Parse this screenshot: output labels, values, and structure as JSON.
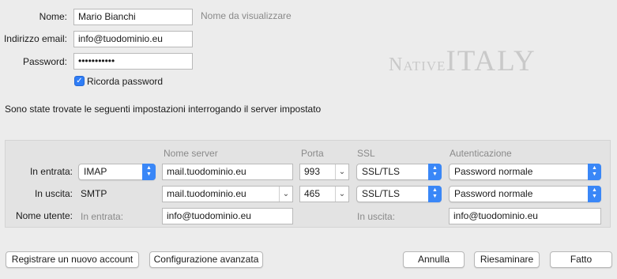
{
  "account": {
    "name_label": "Nome:",
    "name_value": "Mario Bianchi",
    "name_hint": "Nome da visualizzare",
    "email_label": "Indirizzo email:",
    "email_value": "info@tuodominio.eu",
    "password_label": "Password:",
    "password_value": "•••••••••••",
    "remember_label": "Ricorda password",
    "remember_checked": true
  },
  "logo": {
    "part1": "Native",
    "part2": "ITALY"
  },
  "message": "Sono state trovate le seguenti impostazioni interrogando il server impostato",
  "servers": {
    "headers": {
      "server": "Nome server",
      "port": "Porta",
      "ssl": "SSL",
      "auth": "Autenticazione"
    },
    "incoming": {
      "label": "In entrata:",
      "protocol": "IMAP",
      "server": "mail.tuodominio.eu",
      "port": "993",
      "ssl": "SSL/TLS",
      "auth": "Password normale"
    },
    "outgoing": {
      "label": "In uscita:",
      "protocol": "SMTP",
      "server": "mail.tuodominio.eu",
      "port": "465",
      "ssl": "SSL/TLS",
      "auth": "Password normale"
    },
    "username": {
      "label": "Nome utente:",
      "in_label": "In entrata:",
      "in_value": "info@tuodominio.eu",
      "out_label": "In uscita:",
      "out_value": "info@tuodominio.eu"
    }
  },
  "buttons": {
    "new_account": "Registrare un nuovo account",
    "advanced": "Configurazione avanzata",
    "cancel": "Annulla",
    "retest": "Riesaminare",
    "done": "Fatto"
  },
  "colors": {
    "accent": "#3a87f7",
    "background": "#ececec"
  }
}
